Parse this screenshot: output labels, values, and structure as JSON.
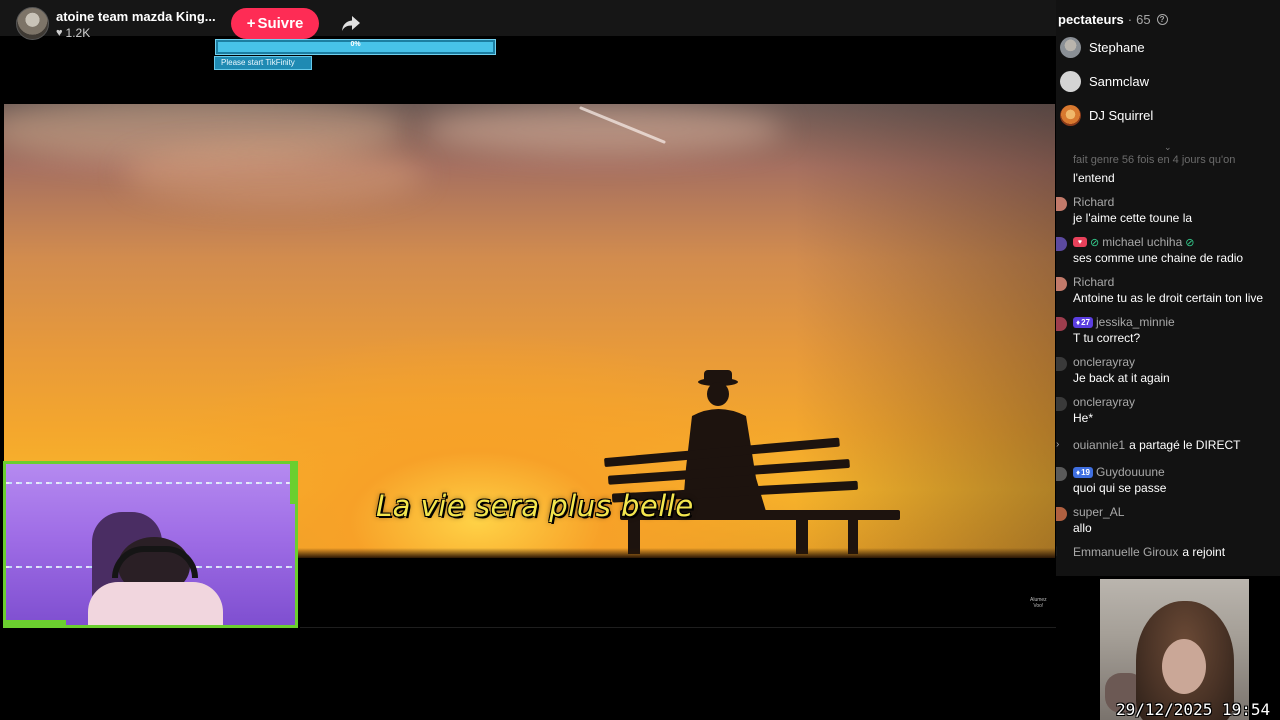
{
  "host": {
    "name": "atoine team mazda King...",
    "likes": "1.2K",
    "follow_label": "Suivre",
    "follow_plus": "+"
  },
  "overlay": {
    "progress_value": 0,
    "progress_text": "0%",
    "hint": "Please start TikFinity"
  },
  "video": {
    "subtitle": "La vie sera plus belle"
  },
  "stream": {
    "watermark_line1": "Alumez",
    "watermark_line2": "Voo!"
  },
  "viewers": {
    "title": "pectateurs",
    "separator": "·",
    "count": "65",
    "help_icon": "?",
    "list": [
      {
        "name": "Stephane",
        "color": "#8a8f95"
      },
      {
        "name": "Sanmclaw",
        "color": "#d4d4d4"
      },
      {
        "name": "DJ Squirrel",
        "color": "#d8792f"
      }
    ]
  },
  "chat": {
    "collapse_icon": "⌄",
    "partial_top": "fait genre 56 fois en 4 jours qu'on",
    "partial_text": "l'entend",
    "messages": [
      {
        "user": "Richard",
        "text": "je l'aime cette toune la",
        "avatar": "#c27a6a"
      },
      {
        "user": "michael uchiha",
        "text": "ses comme une chaine de radio",
        "avatar": "#5c4aa0",
        "badge_heart": "♥",
        "moderator": true
      },
      {
        "user": "Richard",
        "text": "Antoine tu as le droit certain ton live",
        "avatar": "#c27a6a"
      },
      {
        "user": "jessika_minnie",
        "text": "T tu correct?",
        "avatar": "#9d3d4d",
        "level": "27"
      },
      {
        "user": "onclerayray",
        "text": "Je back at it again",
        "avatar": "#3a3a3a"
      },
      {
        "user": "onclerayray",
        "text": "He*",
        "avatar": "#3a3a3a"
      }
    ],
    "share_event": {
      "user": "ouiannie1",
      "action": "a partagé le DIRECT"
    },
    "messages2": [
      {
        "user": "Guydouuune",
        "text": "quoi qui se passe",
        "avatar": "#5a5a5a",
        "level": "19"
      },
      {
        "user": "super_AL",
        "text": "allo",
        "avatar": "#b06040"
      }
    ],
    "join_event": {
      "user": "Emmanuelle Giroux",
      "action": "a rejoint"
    }
  },
  "cam2": {
    "timestamp": "29/12/2025 19:54"
  },
  "colors": {
    "follow": "#fe2c55",
    "progress": "#47c2e9",
    "webcam_border": "#6bcf2f"
  }
}
